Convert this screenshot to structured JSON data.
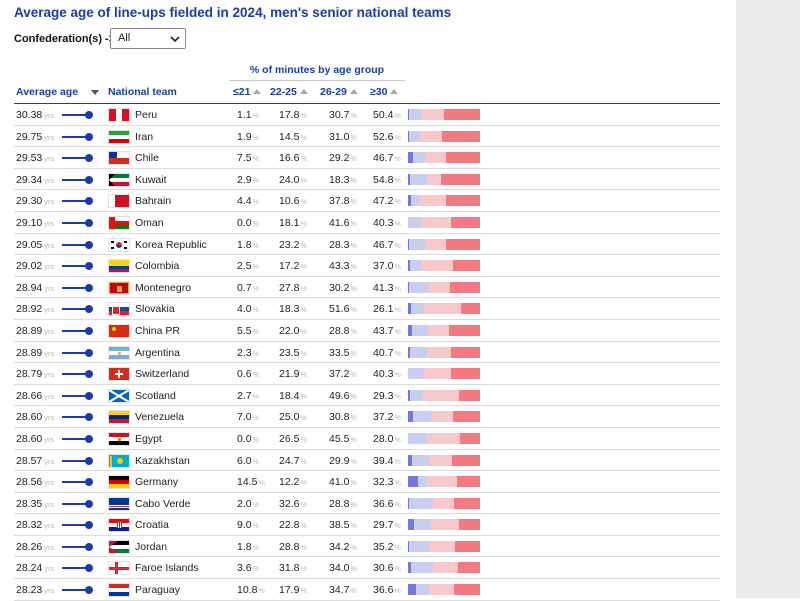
{
  "title": "Average age of line-ups fielded in 2024, men's senior national teams",
  "filter": {
    "label": "Confederation(s) ->",
    "value": "All"
  },
  "header": {
    "group_label": "% of minutes by age group",
    "avg_age": "Average age",
    "team": "National team",
    "c21": "≤21",
    "c2225": "22-25",
    "c2629": "26-29",
    "c30": "≥30"
  },
  "units": {
    "years": "yrs",
    "percent": "%"
  },
  "colors": {
    "accent": "#1a3daa",
    "u21": "#7478d8",
    "a2225": "#c9cdf0",
    "a2629": "#f8c9cc",
    "a30": "#f27a80"
  },
  "rows": [
    {
      "age": "30.38",
      "team": "Peru",
      "flag": "peru",
      "u21": "1.1",
      "a2225": "17.8",
      "a2629": "30.7",
      "a30": "50.4"
    },
    {
      "age": "29.75",
      "team": "Iran",
      "flag": "iran",
      "u21": "1.9",
      "a2225": "14.5",
      "a2629": "31.0",
      "a30": "52.6"
    },
    {
      "age": "29.53",
      "team": "Chile",
      "flag": "chile",
      "u21": "7.5",
      "a2225": "16.6",
      "a2629": "29.2",
      "a30": "46.7"
    },
    {
      "age": "29.34",
      "team": "Kuwait",
      "flag": "kuwait",
      "u21": "2.9",
      "a2225": "24.0",
      "a2629": "18.3",
      "a30": "54.8"
    },
    {
      "age": "29.30",
      "team": "Bahrain",
      "flag": "bahrain",
      "u21": "4.4",
      "a2225": "10.6",
      "a2629": "37.8",
      "a30": "47.2"
    },
    {
      "age": "29.10",
      "team": "Oman",
      "flag": "oman",
      "u21": "0.0",
      "a2225": "18.1",
      "a2629": "41.6",
      "a30": "40.3"
    },
    {
      "age": "29.05",
      "team": "Korea Republic",
      "flag": "korea",
      "u21": "1.8",
      "a2225": "23.2",
      "a2629": "28.3",
      "a30": "46.7"
    },
    {
      "age": "29.02",
      "team": "Colombia",
      "flag": "colombia",
      "u21": "2.5",
      "a2225": "17.2",
      "a2629": "43.3",
      "a30": "37.0"
    },
    {
      "age": "28.94",
      "team": "Montenegro",
      "flag": "montenegro",
      "u21": "0.7",
      "a2225": "27.8",
      "a2629": "30.2",
      "a30": "41.3"
    },
    {
      "age": "28.92",
      "team": "Slovakia",
      "flag": "slovakia",
      "u21": "4.0",
      "a2225": "18.3",
      "a2629": "51.6",
      "a30": "26.1"
    },
    {
      "age": "28.89",
      "team": "China PR",
      "flag": "china",
      "u21": "5.5",
      "a2225": "22.0",
      "a2629": "28.8",
      "a30": "43.7"
    },
    {
      "age": "28.89",
      "team": "Argentina",
      "flag": "argentina",
      "u21": "2.3",
      "a2225": "23.5",
      "a2629": "33.5",
      "a30": "40.7"
    },
    {
      "age": "28.79",
      "team": "Switzerland",
      "flag": "switzerland",
      "u21": "0.6",
      "a2225": "21.9",
      "a2629": "37.2",
      "a30": "40.3"
    },
    {
      "age": "28.66",
      "team": "Scotland",
      "flag": "scotland",
      "u21": "2.7",
      "a2225": "18.4",
      "a2629": "49.6",
      "a30": "29.3"
    },
    {
      "age": "28.60",
      "team": "Venezuela",
      "flag": "venezuela",
      "u21": "7.0",
      "a2225": "25.0",
      "a2629": "30.8",
      "a30": "37.2"
    },
    {
      "age": "28.60",
      "team": "Egypt",
      "flag": "egypt",
      "u21": "0.0",
      "a2225": "26.5",
      "a2629": "45.5",
      "a30": "28.0"
    },
    {
      "age": "28.57",
      "team": "Kazakhstan",
      "flag": "kazakhstan",
      "u21": "6.0",
      "a2225": "24.7",
      "a2629": "29.9",
      "a30": "39.4"
    },
    {
      "age": "28.56",
      "team": "Germany",
      "flag": "germany",
      "u21": "14.5",
      "a2225": "12.2",
      "a2629": "41.0",
      "a30": "32.3"
    },
    {
      "age": "28.35",
      "team": "Cabo Verde",
      "flag": "caboverde",
      "u21": "2.0",
      "a2225": "32.6",
      "a2629": "28.8",
      "a30": "36.6"
    },
    {
      "age": "28.32",
      "team": "Croatia",
      "flag": "croatia",
      "u21": "9.0",
      "a2225": "22.8",
      "a2629": "38.5",
      "a30": "29.7"
    },
    {
      "age": "28.26",
      "team": "Jordan",
      "flag": "jordan",
      "u21": "1.8",
      "a2225": "28.8",
      "a2629": "34.2",
      "a30": "35.2"
    },
    {
      "age": "28.24",
      "team": "Faroe Islands",
      "flag": "faroe",
      "u21": "3.6",
      "a2225": "31.8",
      "a2629": "34.0",
      "a30": "30.6"
    },
    {
      "age": "28.23",
      "team": "Paraguay",
      "flag": "paraguay",
      "u21": "10.8",
      "a2225": "17.9",
      "a2629": "34.7",
      "a30": "36.6"
    }
  ]
}
